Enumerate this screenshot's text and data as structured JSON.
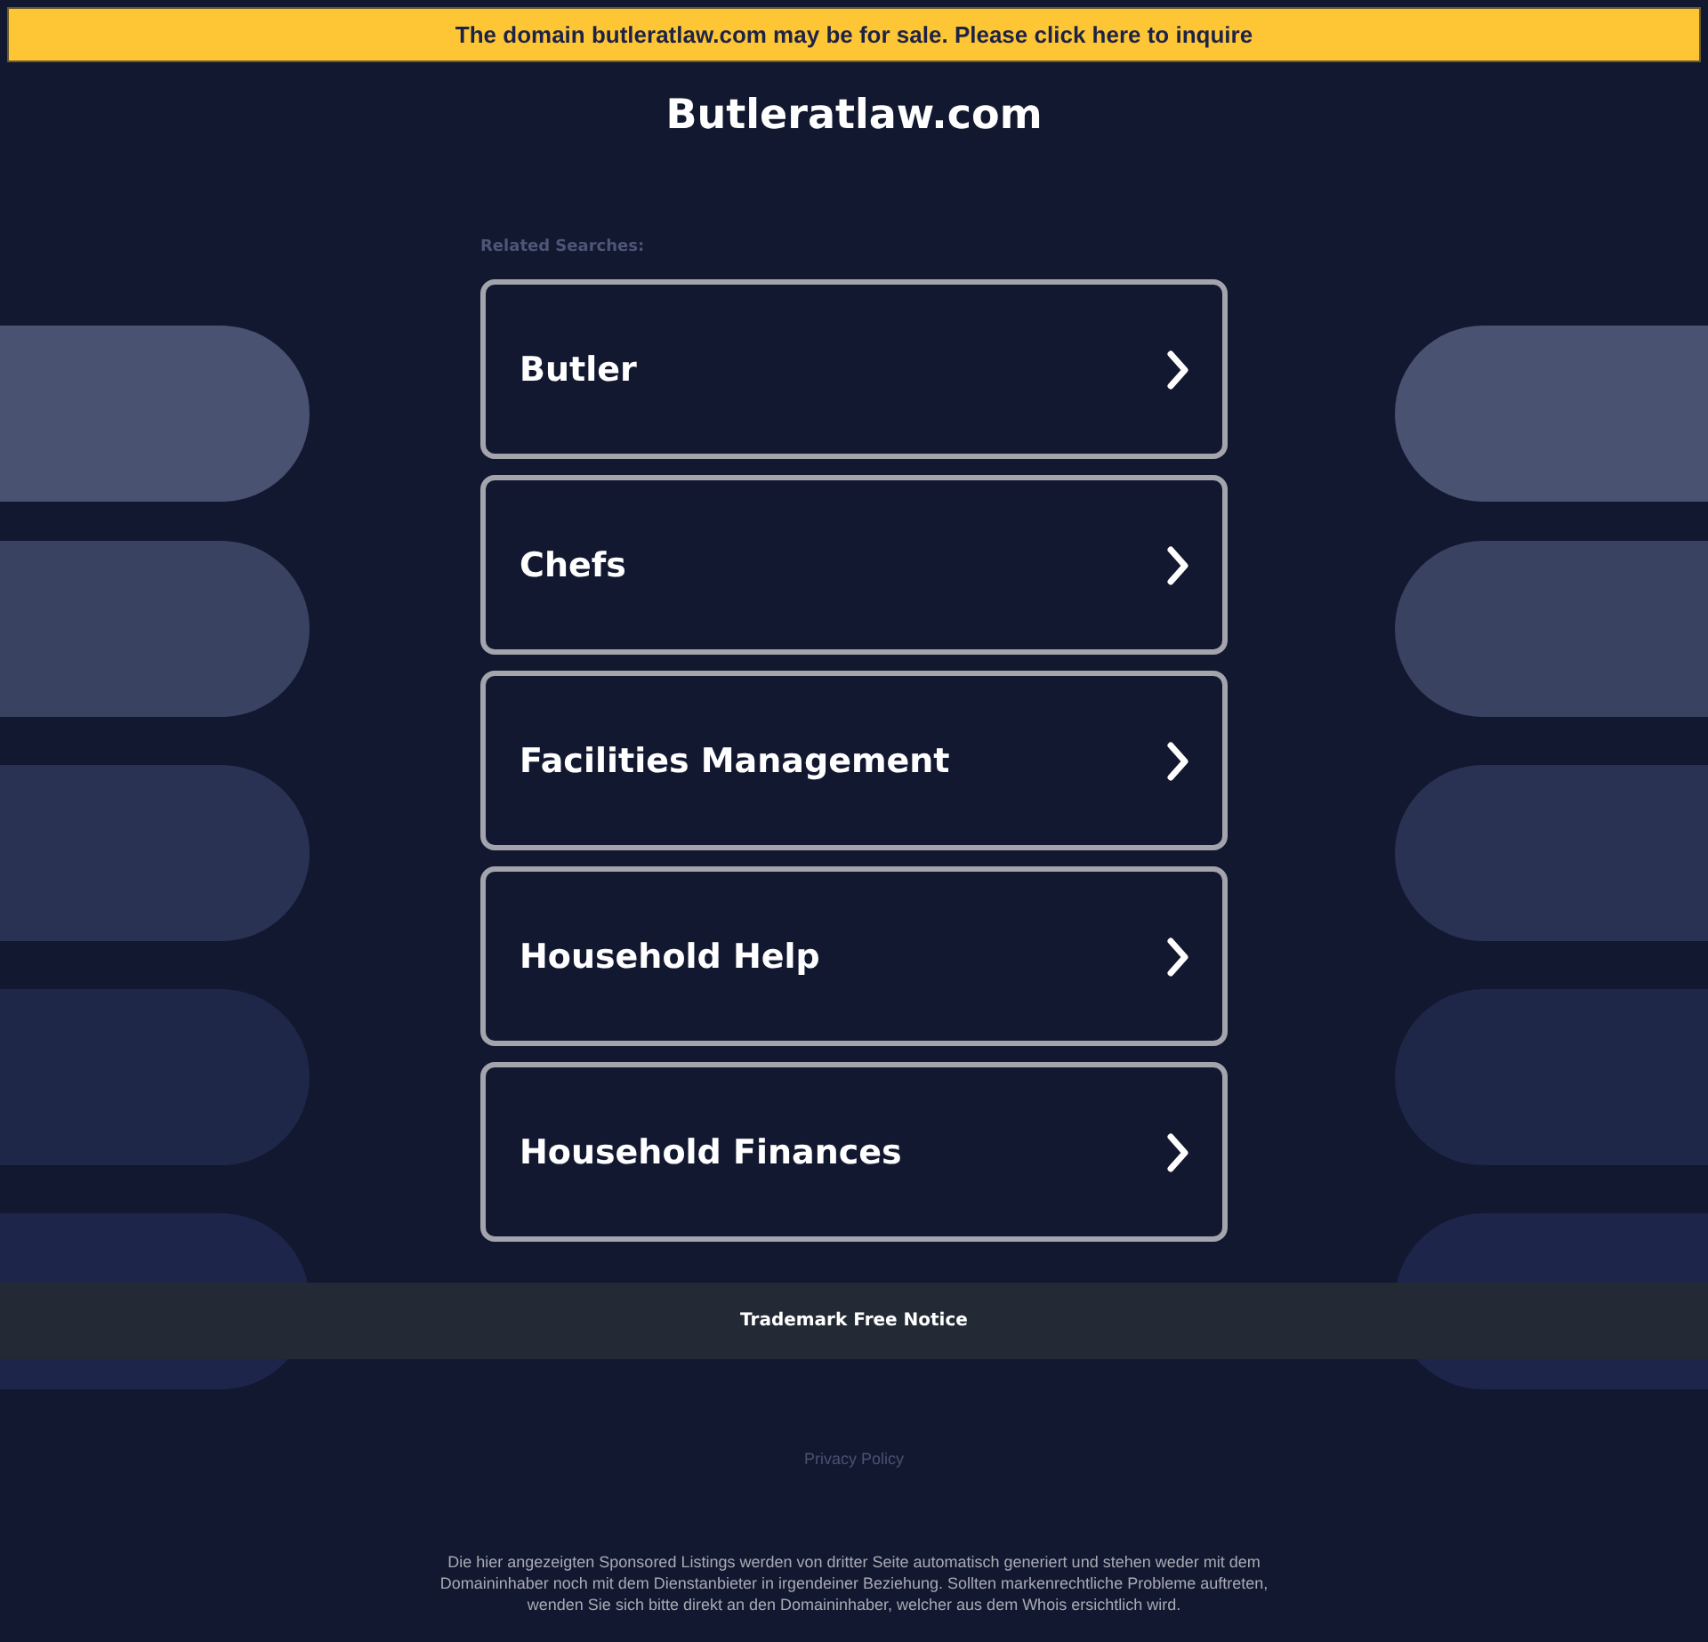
{
  "banner": {
    "text": "The domain butleratlaw.com may be for sale. Please click here to inquire"
  },
  "site_title": "Butleratlaw.com",
  "related_searches": {
    "heading": "Related Searches:",
    "items": [
      {
        "label": "Butler"
      },
      {
        "label": "Chefs"
      },
      {
        "label": "Facilities Management"
      },
      {
        "label": "Household Help"
      },
      {
        "label": "Household Finances"
      }
    ]
  },
  "trademark_notice": "Trademark Free Notice",
  "privacy_policy": "Privacy Policy",
  "disclaimer": "Die hier angezeigten Sponsored Listings werden von dritter Seite automatisch generiert und stehen weder mit dem Domaininhaber noch mit dem Dienstanbieter in irgendeiner Beziehung. Sollten markenrechtliche Probleme auftreten, wenden Sie sich bitte direkt an den Domaininhaber, welcher aus dem Whois ersichtlich wird."
}
